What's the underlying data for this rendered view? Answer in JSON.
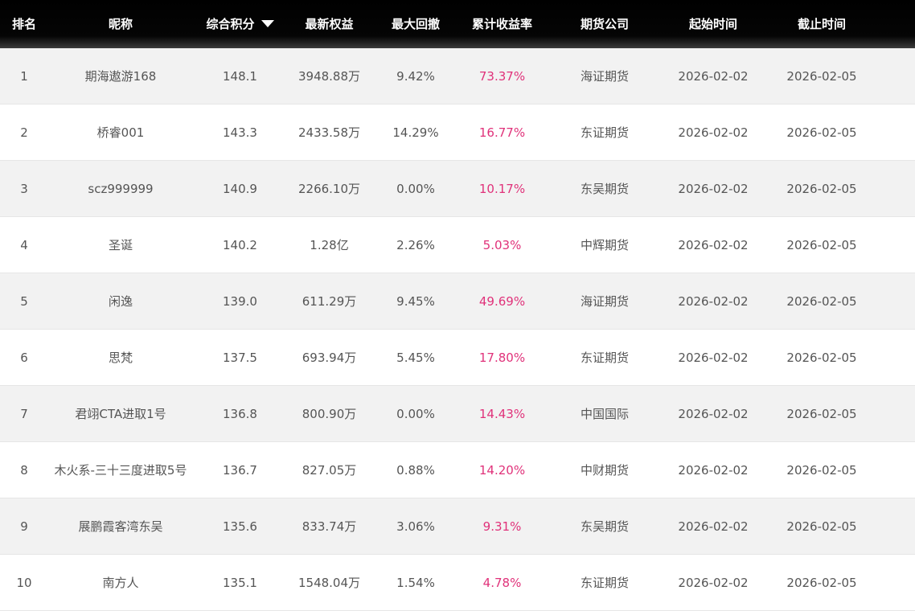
{
  "headers": {
    "rank": "排名",
    "nickname": "昵称",
    "score": "综合积分",
    "equity": "最新权益",
    "max_drawdown": "最大回撤",
    "cum_return": "累计收益率",
    "company": "期货公司",
    "start": "起始时间",
    "end": "截止时间"
  },
  "sort_icon": "caret-down-icon",
  "colors": {
    "header_bg": "#000000",
    "odd_row_bg": "#f2f2f2",
    "return_text": "#e0327a",
    "body_text": "#555555"
  },
  "rows": [
    {
      "rank": "1",
      "nickname": "期海遨游168",
      "score": "148.1",
      "equity": "3948.88万",
      "max_drawdown": "9.42%",
      "cum_return": "73.37%",
      "company": "海证期货",
      "start": "2026-02-02",
      "end": "2026-02-05"
    },
    {
      "rank": "2",
      "nickname": "桥睿001",
      "score": "143.3",
      "equity": "2433.58万",
      "max_drawdown": "14.29%",
      "cum_return": "16.77%",
      "company": "东证期货",
      "start": "2026-02-02",
      "end": "2026-02-05"
    },
    {
      "rank": "3",
      "nickname": "scz999999",
      "score": "140.9",
      "equity": "2266.10万",
      "max_drawdown": "0.00%",
      "cum_return": "10.17%",
      "company": "东吴期货",
      "start": "2026-02-02",
      "end": "2026-02-05"
    },
    {
      "rank": "4",
      "nickname": "圣诞",
      "score": "140.2",
      "equity": "1.28亿",
      "max_drawdown": "2.26%",
      "cum_return": "5.03%",
      "company": "中辉期货",
      "start": "2026-02-02",
      "end": "2026-02-05"
    },
    {
      "rank": "5",
      "nickname": "闲逸",
      "score": "139.0",
      "equity": "611.29万",
      "max_drawdown": "9.45%",
      "cum_return": "49.69%",
      "company": "海证期货",
      "start": "2026-02-02",
      "end": "2026-02-05"
    },
    {
      "rank": "6",
      "nickname": "思梵",
      "score": "137.5",
      "equity": "693.94万",
      "max_drawdown": "5.45%",
      "cum_return": "17.80%",
      "company": "东证期货",
      "start": "2026-02-02",
      "end": "2026-02-05"
    },
    {
      "rank": "7",
      "nickname": "君翊CTA进取1号",
      "score": "136.8",
      "equity": "800.90万",
      "max_drawdown": "0.00%",
      "cum_return": "14.43%",
      "company": "中国国际",
      "start": "2026-02-02",
      "end": "2026-02-05"
    },
    {
      "rank": "8",
      "nickname": "木火系-三十三度进取5号",
      "score": "136.7",
      "equity": "827.05万",
      "max_drawdown": "0.88%",
      "cum_return": "14.20%",
      "company": "中财期货",
      "start": "2026-02-02",
      "end": "2026-02-05"
    },
    {
      "rank": "9",
      "nickname": "展鹏霞客湾东吴",
      "score": "135.6",
      "equity": "833.74万",
      "max_drawdown": "3.06%",
      "cum_return": "9.31%",
      "company": "东吴期货",
      "start": "2026-02-02",
      "end": "2026-02-05"
    },
    {
      "rank": "10",
      "nickname": "南方人",
      "score": "135.1",
      "equity": "1548.04万",
      "max_drawdown": "1.54%",
      "cum_return": "4.78%",
      "company": "东证期货",
      "start": "2026-02-02",
      "end": "2026-02-05"
    }
  ]
}
